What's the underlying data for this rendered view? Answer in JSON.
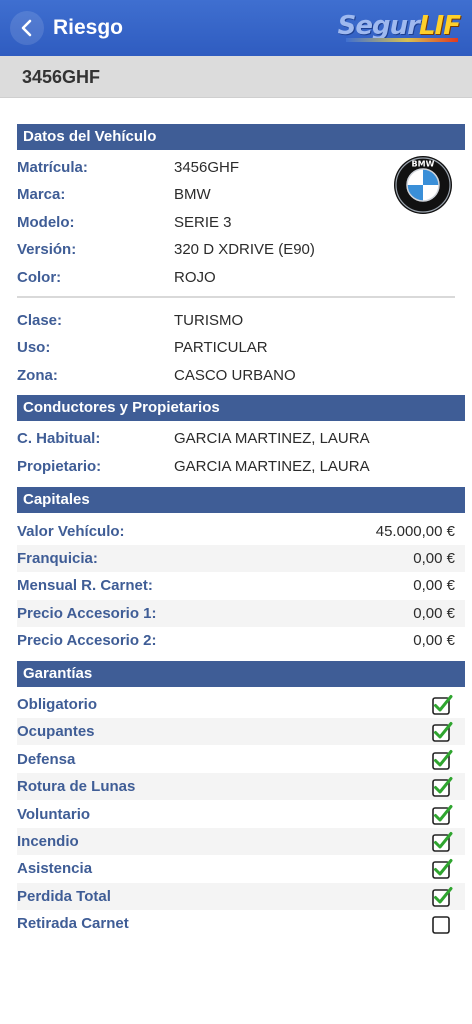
{
  "appbar": {
    "title": "Riesgo",
    "logo_part1": "Segur",
    "logo_part2": "LIF"
  },
  "plate": "3456GHF",
  "vehicle": {
    "header": "Datos del Vehículo",
    "rows": [
      {
        "label": "Matrícula:",
        "value": "3456GHF"
      },
      {
        "label": "Marca:",
        "value": "BMW"
      },
      {
        "label": "Modelo:",
        "value": "SERIE 3"
      },
      {
        "label": "Versión:",
        "value": "320 D XDRIVE (E90)"
      },
      {
        "label": "Color:",
        "value": "ROJO"
      }
    ],
    "rows2": [
      {
        "label": "Clase:",
        "value": "TURISMO"
      },
      {
        "label": "Uso:",
        "value": "PARTICULAR"
      },
      {
        "label": "Zona:",
        "value": "CASCO URBANO"
      }
    ],
    "brand_logo_text": "BMW"
  },
  "drivers": {
    "header": "Conductores y Propietarios",
    "rows": [
      {
        "label": "C. Habitual:",
        "value": "GARCIA MARTINEZ, LAURA"
      },
      {
        "label": "Propietario:",
        "value": "GARCIA MARTINEZ, LAURA"
      }
    ]
  },
  "capitals": {
    "header": "Capitales",
    "rows": [
      {
        "label": "Valor Vehículo:",
        "value": "45.000,00 €"
      },
      {
        "label": "Franquicia:",
        "value": "0,00 €"
      },
      {
        "label": "Mensual R. Carnet:",
        "value": "0,00 €"
      },
      {
        "label": "Precio Accesorio 1:",
        "value": "0,00 €"
      },
      {
        "label": "Precio Accesorio 2:",
        "value": "0,00 €"
      }
    ]
  },
  "guarantees": {
    "header": "Garantías",
    "rows": [
      {
        "label": "Obligatorio",
        "checked": true
      },
      {
        "label": "Ocupantes",
        "checked": true
      },
      {
        "label": "Defensa",
        "checked": true
      },
      {
        "label": "Rotura de Lunas",
        "checked": true
      },
      {
        "label": "Voluntario",
        "checked": true
      },
      {
        "label": "Incendio",
        "checked": true
      },
      {
        "label": "Asistencia",
        "checked": true
      },
      {
        "label": "Perdida Total",
        "checked": true
      },
      {
        "label": "Retirada Carnet",
        "checked": false
      }
    ]
  },
  "colors": {
    "appbar": "#2f5cc0",
    "section_header": "#3f5d96",
    "label": "#3f5d96",
    "check": "#2fa52f"
  }
}
